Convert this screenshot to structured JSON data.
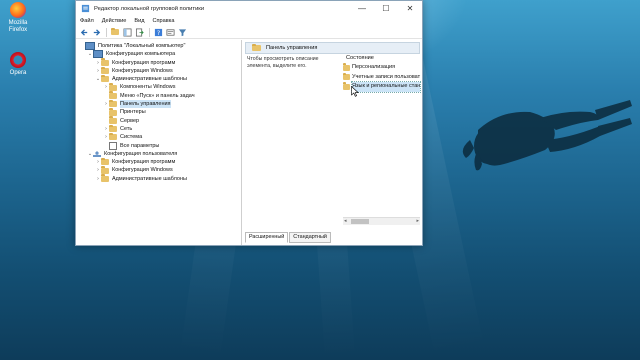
{
  "desktop": {
    "icons": [
      {
        "label": "Mozilla Firefox"
      },
      {
        "label": "Opera"
      }
    ]
  },
  "window": {
    "title": "Редактор локальной групповой политики",
    "controls": {
      "minimize": "—",
      "maximize": "☐",
      "close": "✕"
    },
    "menu": [
      "Файл",
      "Действие",
      "Вид",
      "Справка"
    ],
    "tree": [
      {
        "label": "Политика \"Локальный компьютер\"",
        "level": 0,
        "expander": "",
        "icon": "computer-policy-icon"
      },
      {
        "label": "Конфигурация компьютера",
        "level": 1,
        "expander": "⌄",
        "icon": "computer-icon"
      },
      {
        "label": "Конфигурация программ",
        "level": 2,
        "expander": "›",
        "icon": "folder-icon"
      },
      {
        "label": "Конфигурация Windows",
        "level": 2,
        "expander": "›",
        "icon": "folder-icon"
      },
      {
        "label": "Административные шаблоны",
        "level": 2,
        "expander": "⌄",
        "icon": "folder-icon"
      },
      {
        "label": "Компоненты Windows",
        "level": 3,
        "expander": "›",
        "icon": "folder-icon"
      },
      {
        "label": "Меню «Пуск» и панель задач",
        "level": 3,
        "expander": "",
        "icon": "folder-icon"
      },
      {
        "label": "Панель управления",
        "level": 3,
        "expander": "›",
        "icon": "folder-icon",
        "selected": true
      },
      {
        "label": "Принтеры",
        "level": 3,
        "expander": "",
        "icon": "folder-icon"
      },
      {
        "label": "Сервер",
        "level": 3,
        "expander": "",
        "icon": "folder-icon"
      },
      {
        "label": "Сеть",
        "level": 3,
        "expander": "›",
        "icon": "folder-icon"
      },
      {
        "label": "Система",
        "level": 3,
        "expander": "›",
        "icon": "folder-icon"
      },
      {
        "label": "Все параметры",
        "level": 3,
        "expander": "",
        "icon": "settings-list-icon"
      },
      {
        "label": "Конфигурация пользователя",
        "level": 1,
        "expander": "⌄",
        "icon": "user-icon"
      },
      {
        "label": "Конфигурация программ",
        "level": 2,
        "expander": "›",
        "icon": "folder-icon"
      },
      {
        "label": "Конфигурация Windows",
        "level": 2,
        "expander": "›",
        "icon": "folder-icon"
      },
      {
        "label": "Административные шаблоны",
        "level": 2,
        "expander": "›",
        "icon": "folder-icon"
      }
    ],
    "right_pane": {
      "header": "Панель управления",
      "description": "Чтобы просмотреть описание элемента, выделите его.",
      "column_header": "Состояние",
      "items": [
        {
          "label": "Персонализация",
          "selected": false
        },
        {
          "label": "Учетные записи пользоват",
          "selected": false
        },
        {
          "label": "Язык и региональные стан",
          "selected": true
        }
      ]
    },
    "tabs": [
      {
        "label": "Расширенный",
        "active": true
      },
      {
        "label": "Стандартный",
        "active": false
      }
    ]
  },
  "colors": {
    "folder": "#e8c36a",
    "selection": "#cce4f7",
    "water_top": "#3fa0cc",
    "water_bottom": "#0e3c5a"
  }
}
